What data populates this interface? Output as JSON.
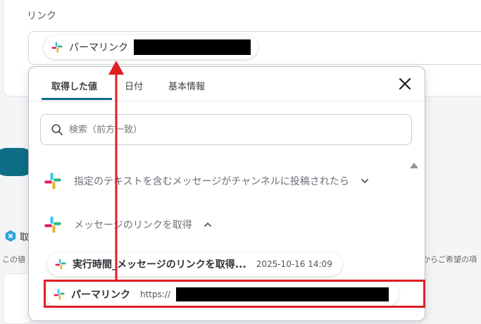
{
  "link_field": {
    "label": "リンク",
    "chip_label": "パーマリンク"
  },
  "popup": {
    "tabs": [
      {
        "label": "取得した値",
        "active": true
      },
      {
        "label": "日付",
        "active": false
      },
      {
        "label": "基本情報",
        "active": false
      }
    ],
    "search": {
      "placeholder": "検索（前方一致）"
    },
    "groups": [
      {
        "label": "指定のテキストを含むメッセージがチャンネルに投稿されたら",
        "expanded": false,
        "icon": "slack-icon"
      },
      {
        "label": "メッセージのリンクを取得",
        "expanded": true,
        "icon": "slack-icon"
      }
    ],
    "items": [
      {
        "name": "実行時間_メッセージのリンクを取得...",
        "value": "2025-10-16 14:09"
      },
      {
        "name": "パーマリンク",
        "value": "https://"
      }
    ]
  },
  "background": {
    "left_char": "取",
    "left_text": "この値",
    "right_text": "からご希望の項"
  },
  "colors": {
    "accent": "#0e6e86",
    "highlight": "#e01e26"
  }
}
